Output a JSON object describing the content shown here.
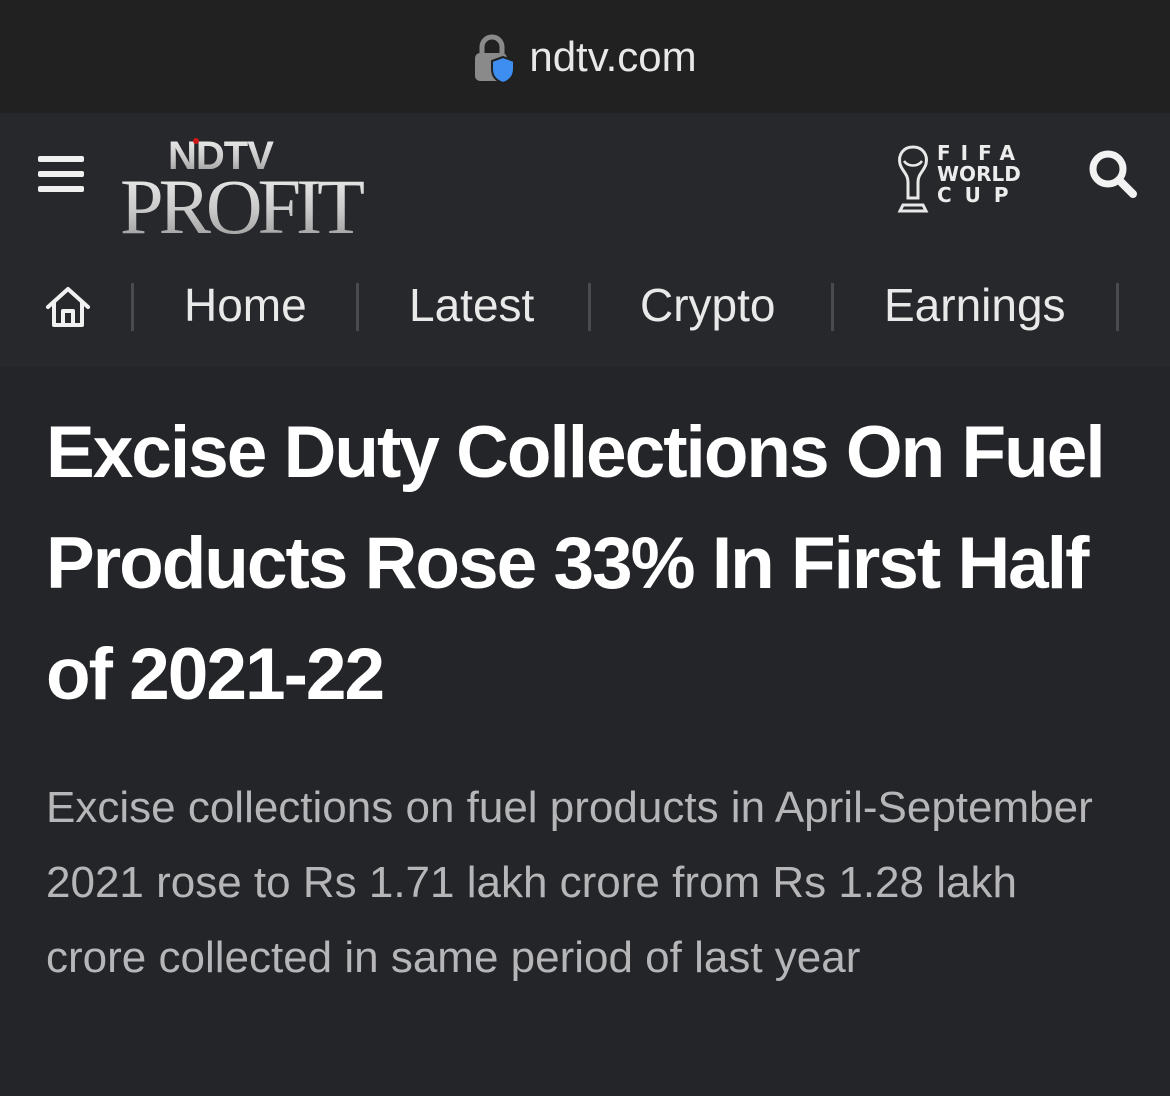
{
  "browser": {
    "url": "ndtv.com"
  },
  "header": {
    "logo_top": "NDTV",
    "logo_bottom": "PROFIT",
    "fifa_line1": "FIFA",
    "fifa_line2": "WORLD",
    "fifa_line3": "CUP"
  },
  "nav": {
    "items": [
      "Home",
      "Latest",
      "Crypto",
      "Earnings"
    ]
  },
  "article": {
    "headline": "Excise Duty Collections On Fuel Products Rose 33% In First Half of 2021-22",
    "summary": "Excise collections on fuel products in April-September 2021 rose to Rs 1.71 lakh crore from Rs 1.28 lakh crore collected in same period of last year"
  },
  "colors": {
    "background": "#242528",
    "header": "#27282b",
    "urlbar": "#212121",
    "headline": "#ffffff",
    "summary": "#b6b6b8",
    "lock_badge": "#3d8ef0"
  }
}
